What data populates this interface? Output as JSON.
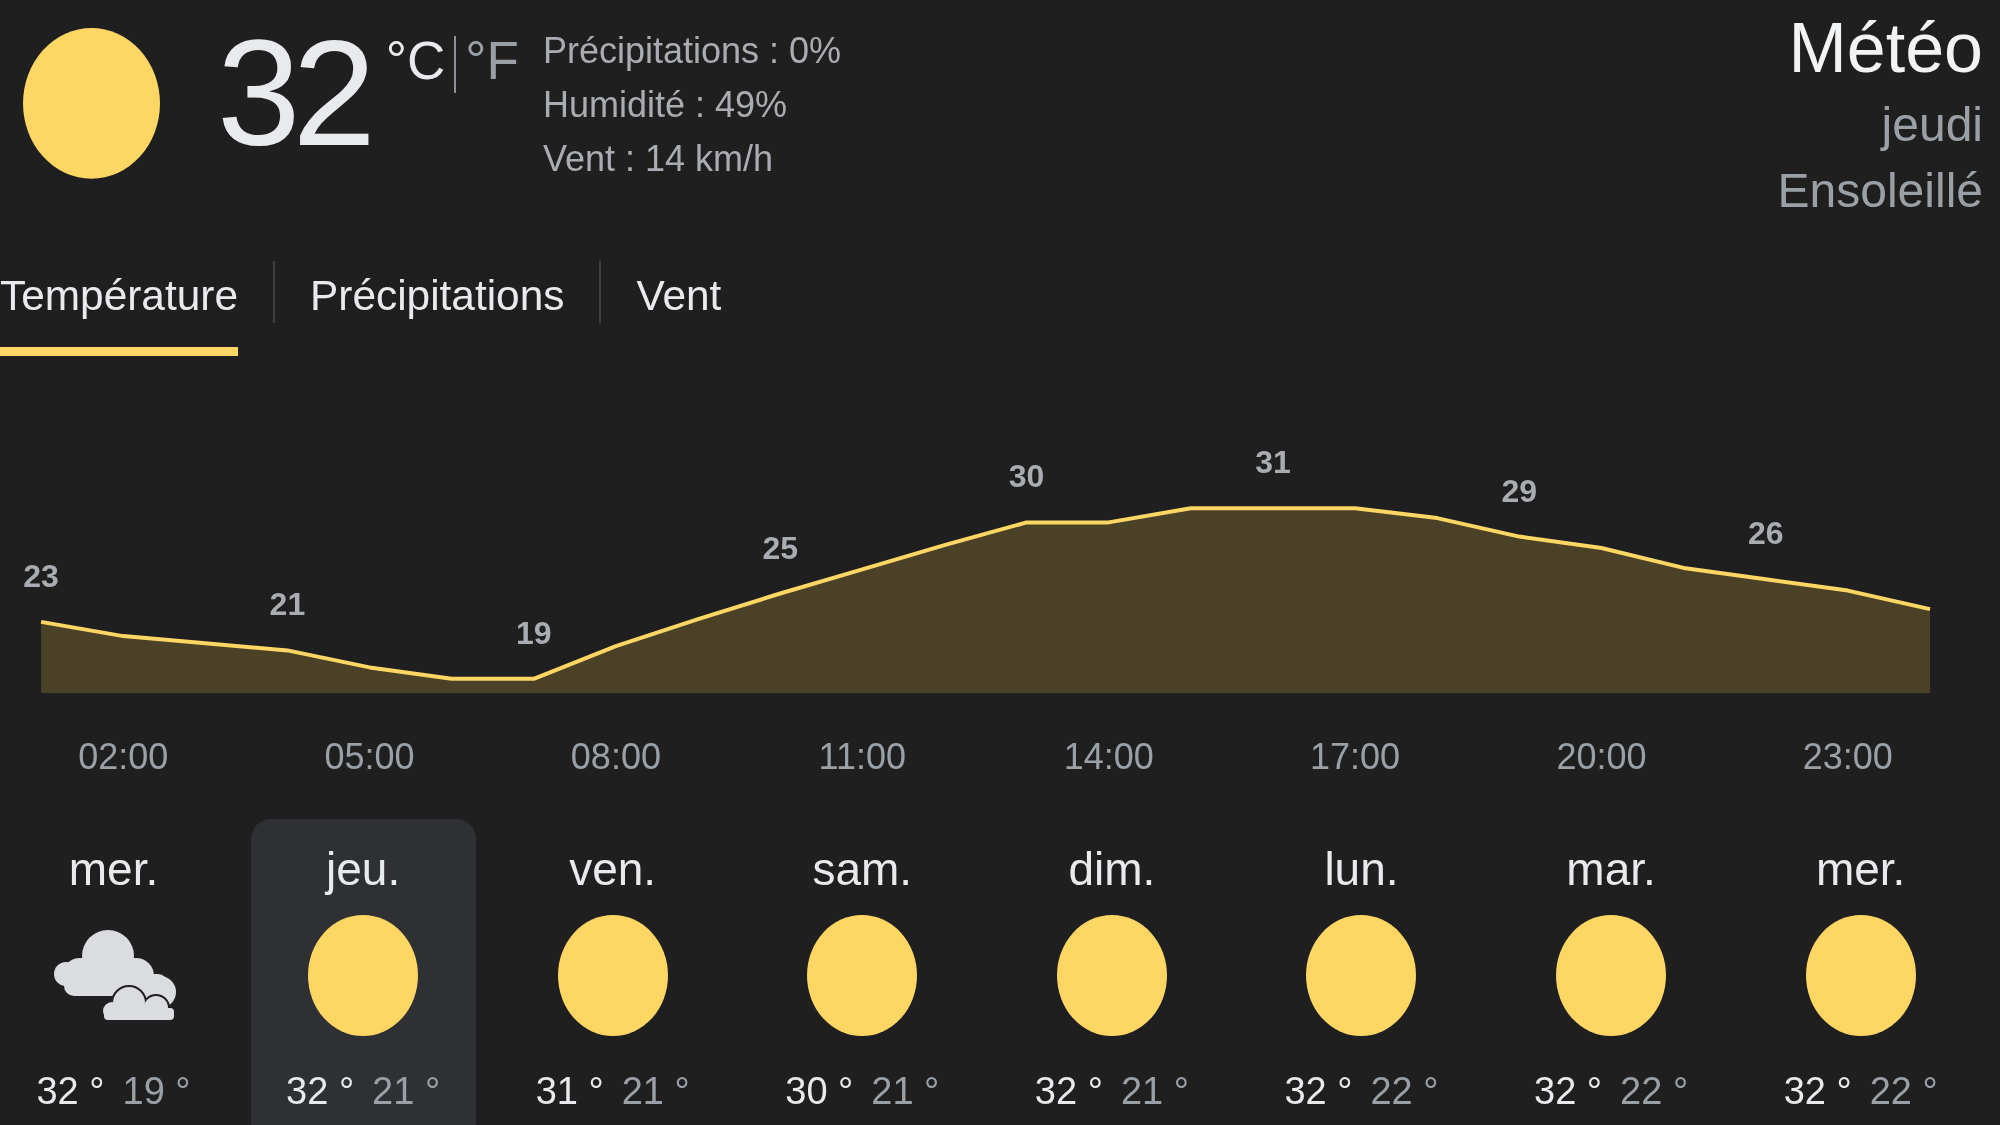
{
  "current": {
    "kind": "sunny",
    "temperature": "32",
    "units": [
      {
        "label": "°C",
        "selected": true
      },
      {
        "label": "°F",
        "selected": false
      }
    ],
    "details": [
      "Précipitations : 0%",
      "Humidité : 49%",
      "Vent : 14 km/h"
    ]
  },
  "header": {
    "title": "Météo",
    "day": "jeudi",
    "condition": "Ensoleillé"
  },
  "tabs": [
    {
      "label": "Température",
      "selected": true
    },
    {
      "label": "Précipitations",
      "selected": false
    },
    {
      "label": "Vent",
      "selected": false
    }
  ],
  "chart": {
    "chart_data": {
      "type": "area",
      "categories": [
        null,
        "02:00",
        null,
        null,
        "05:00",
        null,
        null,
        "08:00",
        null,
        null,
        "11:00",
        null,
        null,
        "14:00",
        null,
        null,
        "17:00",
        null,
        null,
        "20:00",
        null,
        null,
        "23:00",
        null
      ],
      "values": [
        23,
        22,
        21.5,
        21,
        19.8,
        19,
        19,
        21.3,
        23.2,
        25,
        26.7,
        28.4,
        30,
        30,
        31,
        31,
        31,
        30.3,
        29,
        28.2,
        26.8,
        26,
        25.2,
        23.9
      ],
      "value_labels": [
        "23",
        null,
        null,
        "21",
        null,
        null,
        "19",
        null,
        null,
        "25",
        null,
        null,
        "30",
        null,
        null,
        "31",
        null,
        null,
        "29",
        null,
        null,
        "26",
        null,
        null
      ]
    }
  },
  "days": [
    {
      "name": "mer.",
      "kind": "cloudy",
      "high": "32 °",
      "low": "19 °",
      "selected": false
    },
    {
      "name": "jeu.",
      "kind": "sunny",
      "high": "32 °",
      "low": "21 °",
      "selected": true
    },
    {
      "name": "ven.",
      "kind": "sunny",
      "high": "31 °",
      "low": "21 °",
      "selected": false
    },
    {
      "name": "sam.",
      "kind": "sunny",
      "high": "30 °",
      "low": "21 °",
      "selected": false
    },
    {
      "name": "dim.",
      "kind": "sunny",
      "high": "32 °",
      "low": "21 °",
      "selected": false
    },
    {
      "name": "lun.",
      "kind": "sunny",
      "high": "32 °",
      "low": "22 °",
      "selected": false
    },
    {
      "name": "mar.",
      "kind": "sunny",
      "high": "32 °",
      "low": "22 °",
      "selected": false
    },
    {
      "name": "mer.",
      "kind": "sunny",
      "high": "32 °",
      "low": "22 °",
      "selected": false
    }
  ]
}
